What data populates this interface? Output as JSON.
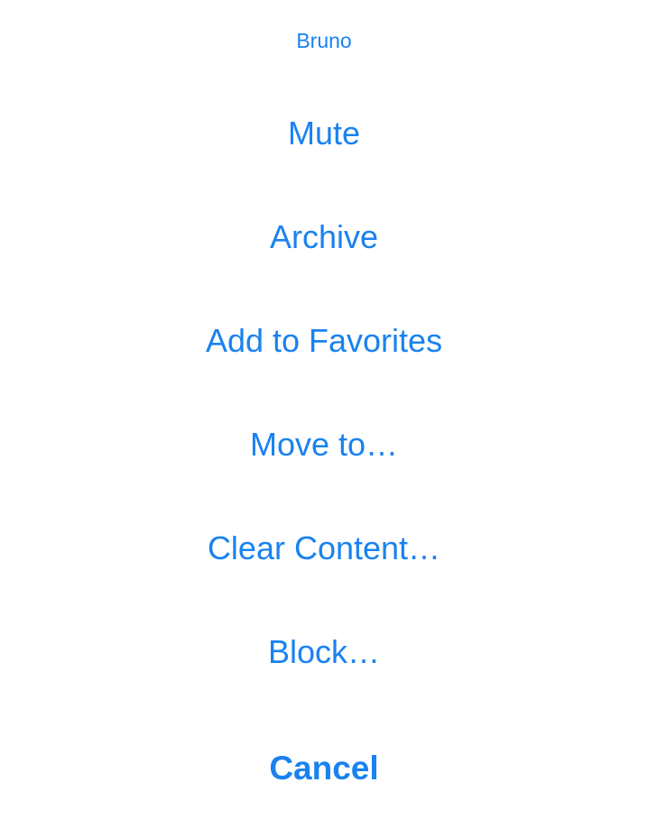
{
  "sheet": {
    "title": "Bruno",
    "actions": [
      {
        "label": "Mute"
      },
      {
        "label": "Archive"
      },
      {
        "label": "Add to Favorites"
      },
      {
        "label": "Move to…"
      },
      {
        "label": "Clear Content…"
      },
      {
        "label": "Block…"
      }
    ],
    "cancel_label": "Cancel"
  },
  "colors": {
    "accent": "#1A82F0",
    "background": "#FFFFFF"
  }
}
